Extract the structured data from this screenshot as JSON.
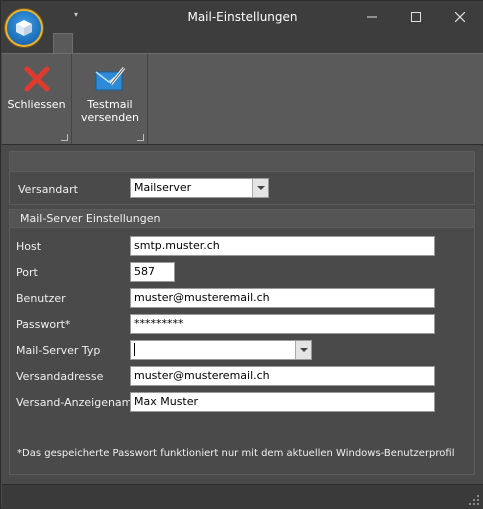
{
  "window": {
    "title": "Mail-Einstellungen",
    "qat_symbol": "▾"
  },
  "icons": {
    "app": "app-cube-icon",
    "close_window": "close-icon",
    "minimize": "minimize-icon",
    "maximize": "maximize-icon",
    "schliessen": "red-x-icon",
    "testmail": "mail-pen-icon"
  },
  "colors": {
    "accent_orb": "#1a6bb5",
    "close_x": "#e03a2f",
    "mail_icon": "#2e8ad6"
  },
  "ribbon": {
    "close_label": "Schliessen",
    "testmail_label_1": "Testmail",
    "testmail_label_2": "versenden"
  },
  "form": {
    "versandart_label": "Versandart",
    "versandart_value": "Mailserver",
    "section_title": "Mail-Server Einstellungen",
    "host_label": "Host",
    "host_value": "smtp.muster.ch",
    "port_label": "Port",
    "port_value": "587",
    "user_label": "Benutzer",
    "user_value": "muster@musteremail.ch",
    "password_label": "Passwort*",
    "password_value": "*********",
    "servertype_label": "Mail-Server Typ",
    "servertype_value": "",
    "sender_label": "Versandadresse",
    "sender_value": "muster@musteremail.ch",
    "displayname_label": "Versand-Anzeigename",
    "displayname_value": "Max Muster",
    "note": "*Das gespeicherte Passwort funktioniert nur  mit dem aktuellen Windows-Benutzerprofil"
  }
}
